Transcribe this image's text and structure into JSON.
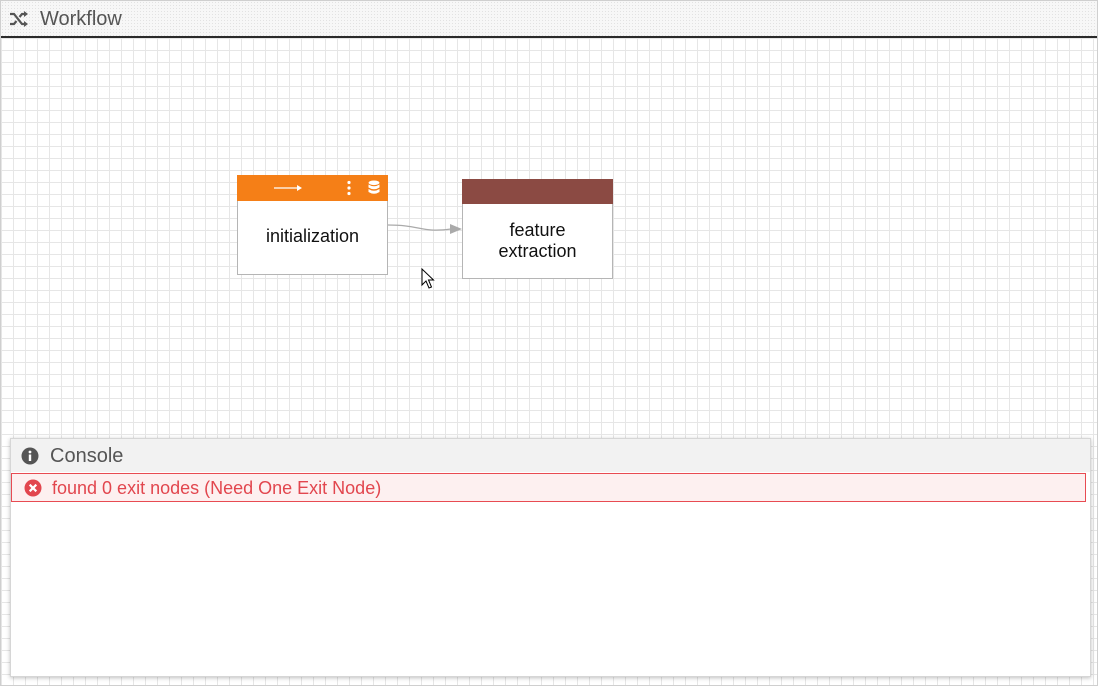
{
  "window": {
    "title": "Workflow",
    "icon": "shuffle-icon"
  },
  "canvas": {
    "nodes": [
      {
        "label": "initialization",
        "header_color": "#f57f17",
        "header_icons": [
          "arrow-right-icon",
          "dots-vertical-icon",
          "database-icon"
        ]
      },
      {
        "label_line1": "feature",
        "label_line2": "extraction",
        "header_color": "#8b4a43"
      }
    ],
    "edges": [
      {
        "from": "initialization",
        "to": "feature extraction"
      }
    ]
  },
  "console": {
    "title": "Console",
    "icon": "info-circle-icon",
    "messages": [
      {
        "level": "error",
        "icon": "error-circle-icon",
        "text": "found 0 exit nodes (Need One Exit Node)",
        "color": "#e2464e"
      }
    ]
  }
}
